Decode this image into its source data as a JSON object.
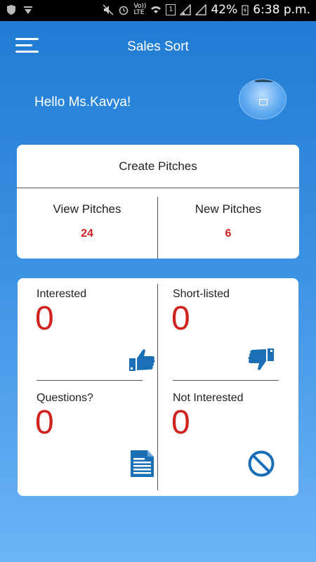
{
  "status_bar": {
    "battery": "42%",
    "time": "6:38 p.m.",
    "network_volte": "Vo)) LTE",
    "sim_slot": "1"
  },
  "app": {
    "title": "Sales Sort",
    "menu_icon": "hamburger-menu-icon"
  },
  "greeting": "Hello Ms.Kavya!",
  "pitches": {
    "create_label": "Create Pitches",
    "view_label": "View Pitches",
    "view_count": "24",
    "new_label": "New Pitches",
    "new_count": "6"
  },
  "stats": [
    {
      "label": "Interested",
      "value": "0",
      "icon": "thumbs-up-icon"
    },
    {
      "label": "Short-listed",
      "value": "0",
      "icon": "thumbs-down-icon"
    },
    {
      "label": "Questions?",
      "value": "0",
      "icon": "document-icon"
    },
    {
      "label": "Not Interested",
      "value": "0",
      "icon": "prohibited-icon"
    }
  ],
  "colors": {
    "accent_blue": "#1e7ad2",
    "count_red": "#d0231f",
    "icon_blue": "#1a6fb5"
  }
}
